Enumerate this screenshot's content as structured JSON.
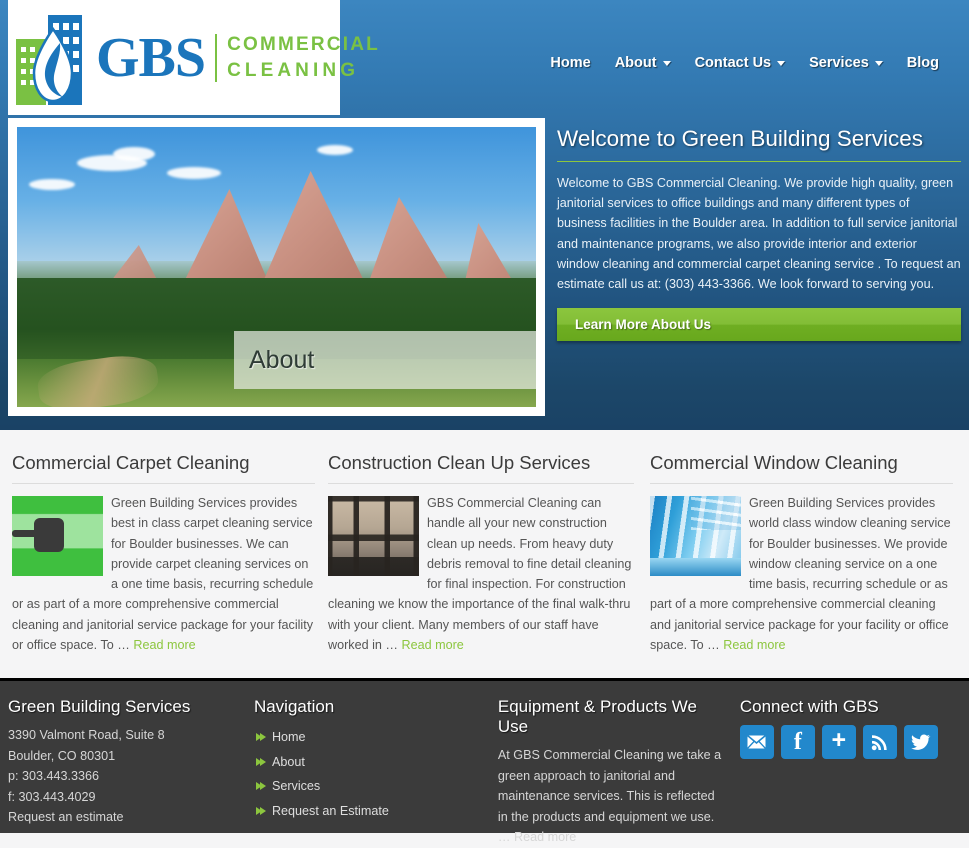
{
  "site": {
    "logo": {
      "brand": "GBS",
      "tagline_line1": "COMMERCIAL",
      "tagline_line2": "CLEANING",
      "alt": "GBS Commercial Cleaning logo"
    },
    "nav": [
      {
        "label": "Home",
        "has_dropdown": false
      },
      {
        "label": "About",
        "has_dropdown": true
      },
      {
        "label": "Contact Us",
        "has_dropdown": true
      },
      {
        "label": "Services",
        "has_dropdown": true
      },
      {
        "label": "Blog",
        "has_dropdown": false
      }
    ]
  },
  "slider": {
    "caption": "About",
    "image_alt": "Boulder Flatirons rock formation with green forest and meadow"
  },
  "welcome": {
    "heading": "Welcome to Green Building Services",
    "body": "Welcome to GBS Commercial Cleaning.  We provide high quality, green janitorial services to office buildings and many different types of business facilities in the Boulder area.  In addition to full service janitorial and maintenance programs, we also provide interior and exterior window cleaning and commercial carpet cleaning service .  To request an estimate call us at: (303) 443-3366.  We look forward to serving you.",
    "cta_label": "Learn More About Us",
    "accent_color": "#8cc63e"
  },
  "services": [
    {
      "title": "Commercial Carpet Cleaning",
      "body": "Green Building Services provides best in class carpet cleaning service for Boulder businesses.  We can provide carpet cleaning services on a one time basis, recurring schedule or as part of a more comprehensive commercial cleaning and janitorial service package for your facility or office space.  To … ",
      "read_more": "Read more",
      "thumb_alt": "Vacuum cleaner head on green carpet"
    },
    {
      "title": "Construction Clean Up Services",
      "body": "GBS Commercial Cleaning can handle all your new construction clean up needs.  From heavy duty debris removal to fine detail cleaning for final inspection.  For construction cleaning we know the importance of the final walk-thru with your client. Many members of our staff have worked in … ",
      "read_more": "Read more",
      "thumb_alt": "Interior of a building under construction with window frames"
    },
    {
      "title": "Commercial Window Cleaning",
      "body": "Green Building Services provides world class window cleaning service for Boulder businesses.  We provide window cleaning service on a one time basis, recurring schedule or as part of a more comprehensive commercial cleaning and janitorial service package for your facility or office space.  To … ",
      "read_more": "Read more",
      "thumb_alt": "Sunlit corridor with large blue windows"
    }
  ],
  "footer": {
    "company": {
      "title": "Green Building Services",
      "address_line1": "3390 Valmont Road, Suite 8",
      "address_line2": "Boulder, CO 80301",
      "phone": "p: 303.443.3366",
      "fax": "f: 303.443.4029",
      "estimate_link": "Request an estimate"
    },
    "navigation": {
      "title": "Navigation",
      "items": [
        {
          "label": "Home"
        },
        {
          "label": "About"
        },
        {
          "label": "Services"
        },
        {
          "label": "Request an Estimate"
        }
      ]
    },
    "equipment": {
      "title": "Equipment & Products We Use",
      "body": "At GBS Commercial Cleaning we take a green approach to janitorial and maintenance services.  This is reflected in the products and equipment we use.",
      "ellipsis": "… ",
      "read_more": "Read more"
    },
    "connect": {
      "title": "Connect with GBS",
      "icons": [
        {
          "name": "email-icon",
          "glyph": "✉"
        },
        {
          "name": "facebook-icon",
          "glyph": "f"
        },
        {
          "name": "google-plus-icon",
          "glyph": "+"
        },
        {
          "name": "rss-icon",
          "glyph": "rss"
        },
        {
          "name": "twitter-icon",
          "glyph": "🐦"
        }
      ],
      "icon_color": "#2288cc"
    }
  }
}
